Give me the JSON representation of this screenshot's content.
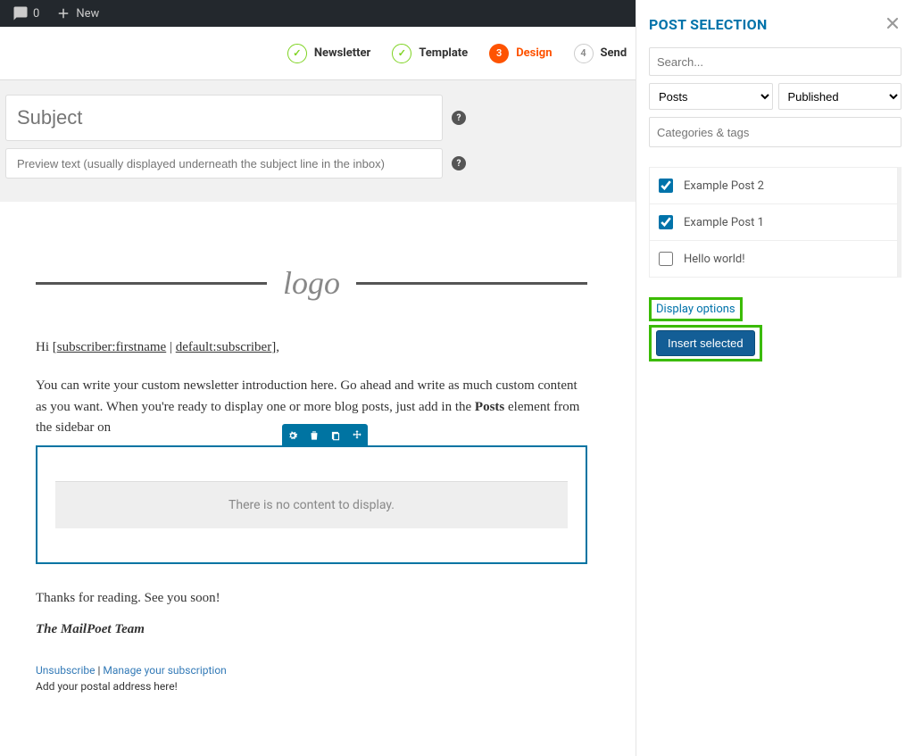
{
  "adminBar": {
    "commentCount": "0",
    "newLabel": "New"
  },
  "steps": {
    "s1": "Newsletter",
    "s2": "Template",
    "s3": "Design",
    "s3num": "3",
    "s4": "Send",
    "s4num": "4",
    "check": "✓"
  },
  "subject": {
    "placeholder": "Subject",
    "previewPlaceholder": "Preview text (usually displayed underneath the subject line in the inbox)"
  },
  "editor": {
    "logoText": "logo",
    "greeting_pre": "Hi [",
    "greeting_var1": "subscriber:firstname",
    "greeting_sep": " | ",
    "greeting_var2": "default:subscriber",
    "greeting_post": "],",
    "body1": "You can write your custom newsletter introduction here. Go ahead and write as much custom content as you want. When you're ready to display one or more blog posts, just add in the ",
    "body_bold": "Posts",
    "body2": " element from the sidebar on",
    "noContent": "There is no content to display.",
    "signoff": "Thanks for reading. See you soon!",
    "team": "The MailPoet Team",
    "unsub": "Unsubscribe",
    "sepPipe": " | ",
    "manage": "Manage your subscription",
    "address": "Add your postal address here!"
  },
  "panel": {
    "title": "POST SELECTION",
    "searchPlaceholder": "Search...",
    "typeSelect": "Posts",
    "statusSelect": "Published",
    "catsPlaceholder": "Categories & tags",
    "posts": {
      "0": {
        "label": "Example Post 2",
        "checked": true
      },
      "1": {
        "label": "Example Post 1",
        "checked": true
      },
      "2": {
        "label": "Hello world!",
        "checked": false
      }
    },
    "displayOptions": "Display options",
    "insertBtn": "Insert selected"
  }
}
